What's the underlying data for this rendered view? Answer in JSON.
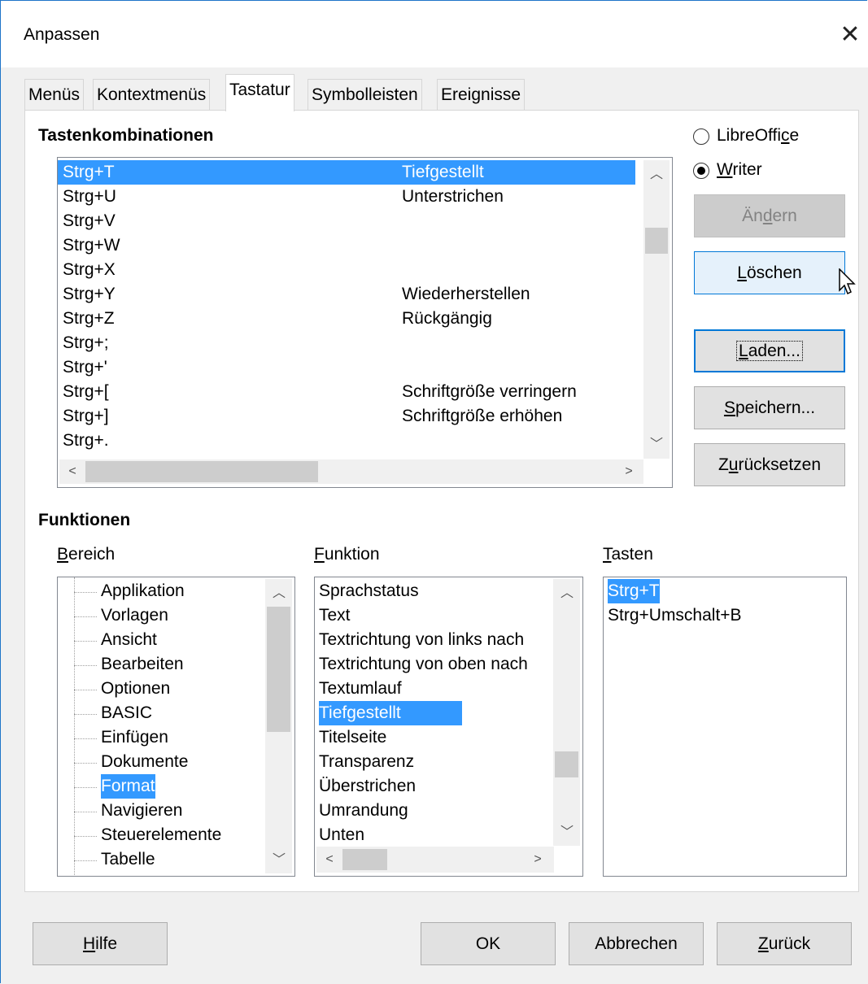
{
  "window": {
    "title": "Anpassen",
    "close_glyph": "✕"
  },
  "tabs": [
    {
      "label": "Menüs"
    },
    {
      "label": "Kontextmenüs"
    },
    {
      "label": "Tastatur"
    },
    {
      "label": "Symbolleisten"
    },
    {
      "label": "Ereignisse"
    }
  ],
  "shortcuts": {
    "title": "Tastenkombinationen",
    "rows": [
      {
        "key": "Strg+T",
        "func": "Tiefgestellt"
      },
      {
        "key": "Strg+U",
        "func": "Unterstrichen"
      },
      {
        "key": "Strg+V",
        "func": ""
      },
      {
        "key": "Strg+W",
        "func": ""
      },
      {
        "key": "Strg+X",
        "func": ""
      },
      {
        "key": "Strg+Y",
        "func": "Wiederherstellen"
      },
      {
        "key": "Strg+Z",
        "func": "Rückgängig"
      },
      {
        "key": "Strg+;",
        "func": ""
      },
      {
        "key": "Strg+'",
        "func": ""
      },
      {
        "key": "Strg+[",
        "func": "Schriftgröße verringern"
      },
      {
        "key": "Strg+]",
        "func": "Schriftgröße erhöhen"
      },
      {
        "key": "Strg+.",
        "func": ""
      }
    ]
  },
  "scope": {
    "libreoffice": {
      "pre": "LibreOffi",
      "u": "c",
      "post": "e"
    },
    "writer": {
      "pre": "",
      "u": "W",
      "post": "riter"
    }
  },
  "buttons": {
    "aendern": {
      "pre": "Än",
      "u": "d",
      "post": "ern"
    },
    "loeschen": {
      "pre": "",
      "u": "L",
      "post": "öschen"
    },
    "laden": {
      "pre": "",
      "u": "L",
      "post": "aden..."
    },
    "speichern": {
      "pre": "",
      "u": "S",
      "post": "peichern..."
    },
    "zuruecksetzen": {
      "pre": "Z",
      "u": "u",
      "post": "rücksetzen"
    },
    "hilfe": {
      "pre": "",
      "u": "H",
      "post": "ilfe"
    },
    "ok": "OK",
    "abbrechen": "Abbrechen",
    "zurueck": {
      "pre": "",
      "u": "Z",
      "post": "urück"
    }
  },
  "functions": {
    "title": "Funktionen",
    "bereich_label": {
      "pre": "",
      "u": "B",
      "post": "ereich"
    },
    "funktion_label": {
      "pre": "",
      "u": "F",
      "post": "unktion"
    },
    "tasten_label": {
      "pre": "",
      "u": "T",
      "post": "asten"
    },
    "bereich_items": [
      "Applikation",
      "Vorlagen",
      "Ansicht",
      "Bearbeiten",
      "Optionen",
      "BASIC",
      "Einfügen",
      "Dokumente",
      "Format",
      "Navigieren",
      "Steuerelemente",
      "Tabelle"
    ],
    "funktion_items": [
      "Sprachstatus",
      "Text",
      "Textrichtung von links nach",
      "Textrichtung von oben nach",
      "Textumlauf",
      "Tiefgestellt",
      "Titelseite",
      "Transparenz",
      "Überstrichen",
      "Umrandung",
      "Unten"
    ],
    "tasten_items": [
      "Strg+T",
      "Strg+Umschalt+B"
    ]
  },
  "icons": {
    "up": "chevron-up-icon",
    "down": "chevron-down-icon",
    "left": "chevron-left-icon",
    "right": "chevron-right-icon"
  },
  "colors": {
    "selection": "#3399ff",
    "accent": "#0078d7"
  }
}
